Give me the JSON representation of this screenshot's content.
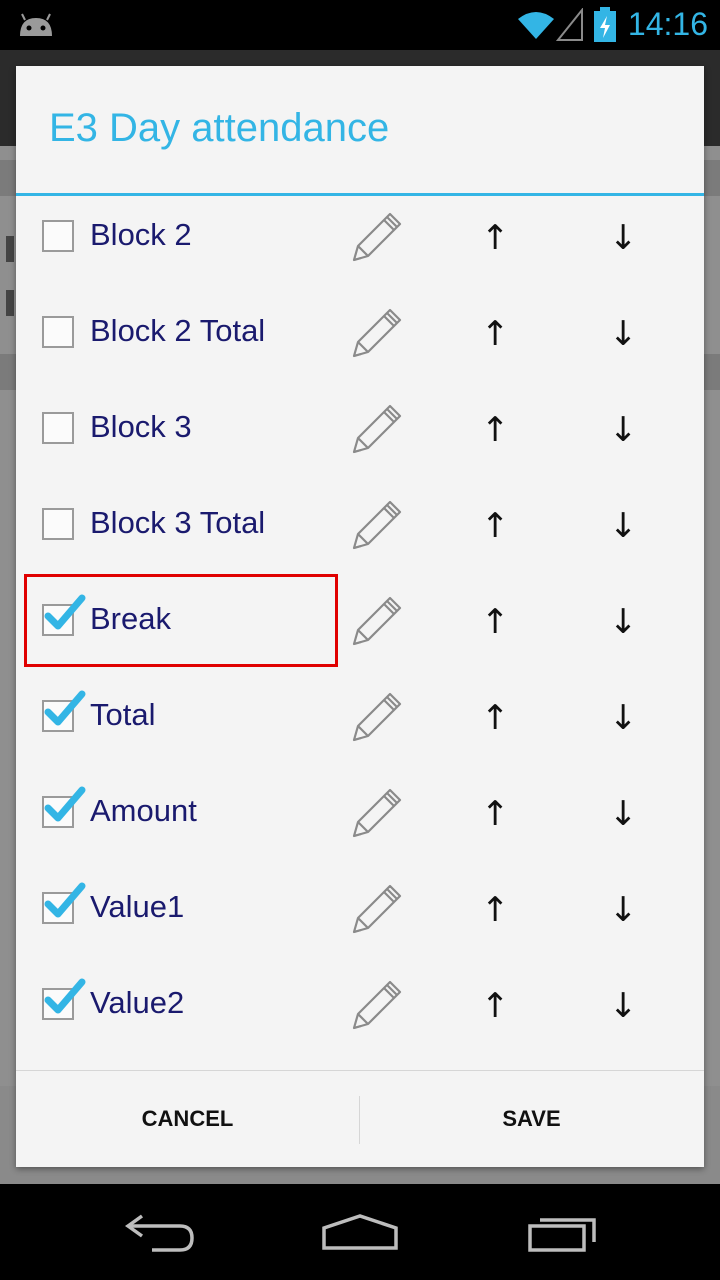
{
  "status_bar": {
    "time": "14:16",
    "icons": [
      "android-icon",
      "wifi-icon",
      "signal-icon",
      "battery-charging-icon"
    ],
    "accent_color": "#33b5e5"
  },
  "dialog": {
    "title": "E3 Day attendance",
    "title_color": "#33b5e5",
    "items": [
      {
        "label": "Block 2",
        "checked": false
      },
      {
        "label": "Block 2 Total",
        "checked": false
      },
      {
        "label": "Block 3",
        "checked": false
      },
      {
        "label": "Block 3 Total",
        "checked": false
      },
      {
        "label": "Break",
        "checked": true,
        "highlighted": true
      },
      {
        "label": "Total",
        "checked": true
      },
      {
        "label": "Amount",
        "checked": true
      },
      {
        "label": "Value1",
        "checked": true
      },
      {
        "label": "Value2",
        "checked": true
      }
    ],
    "row_icons": {
      "edit": "pencil-icon",
      "move_up": "↑",
      "move_down": "↓"
    },
    "highlight_color": "#e00000",
    "buttons": {
      "cancel": "CANCEL",
      "save": "SAVE"
    }
  },
  "nav_bar": {
    "icons": [
      "back-icon",
      "home-icon",
      "recents-icon"
    ]
  }
}
